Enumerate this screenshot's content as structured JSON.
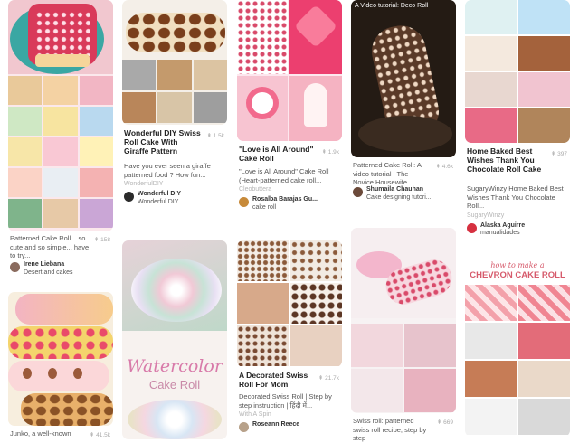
{
  "pins": {
    "c1a": {
      "desc": "Patterned Cake Roll... so cute and so simple... have to try...",
      "repins": "158",
      "user": "Irene Liebana",
      "board": "Desert and cakes"
    },
    "c1b": {
      "desc": "Junko, a well-known",
      "repins": "41.5k"
    },
    "c2a": {
      "title": "Wonderful DIY Swiss Roll Cake With Giraffe Pattern",
      "repins": "1.5k",
      "desc": "Have you ever seen a giraffe patterned food ? How fun...",
      "source": "WonderfulDIY",
      "user": "Wonderful DIY",
      "board": "Wonderful DIY"
    },
    "c2b": {
      "overlay1": "Watercolor",
      "overlay2": "Cake Roll"
    },
    "c3a": {
      "title": "\"Love is All Around\" Cake Roll",
      "repins": "1.9k",
      "desc": "\"Love is All Around\" Cake Roll (Heart-patterned cake roll...",
      "source": "Cleobuttera",
      "user": "Rosalba Barajas Gu...",
      "board": "cake roll"
    },
    "c3b": {
      "title": "A Decorated Swiss Roll For Mom",
      "repins": "21.7k",
      "desc": "Decorated Swiss Roll | Step by step instruction | हिंदी में...",
      "source": "With A Spin",
      "user": "Roseann Reece"
    },
    "c4a": {
      "overlay": "A Video tutorial: Deco Roll",
      "desc": "Patterned Cake Roll: A video tutorial | The Novice Housewife",
      "repins": "4.6k",
      "user": "Shumaila Chauhan",
      "board": "Cake designing tutori..."
    },
    "c4b": {
      "desc": "Swiss roll: patterned swiss roll recipe, step by step",
      "repins": "669"
    },
    "c5a": {
      "title": "Home Baked Best Wishes Thank You Chocolate Roll Cake",
      "repins": "397",
      "desc": "SugaryWinzy Home Baked Best Wishes Thank You Chocolate Roll...",
      "source": "SugaryWinzy",
      "user": "Alaska Aguirre",
      "board": "manualidades"
    },
    "c5b": {
      "overlay1": "how to make a",
      "overlay2": "CHEVRON CAKE ROLL"
    }
  }
}
